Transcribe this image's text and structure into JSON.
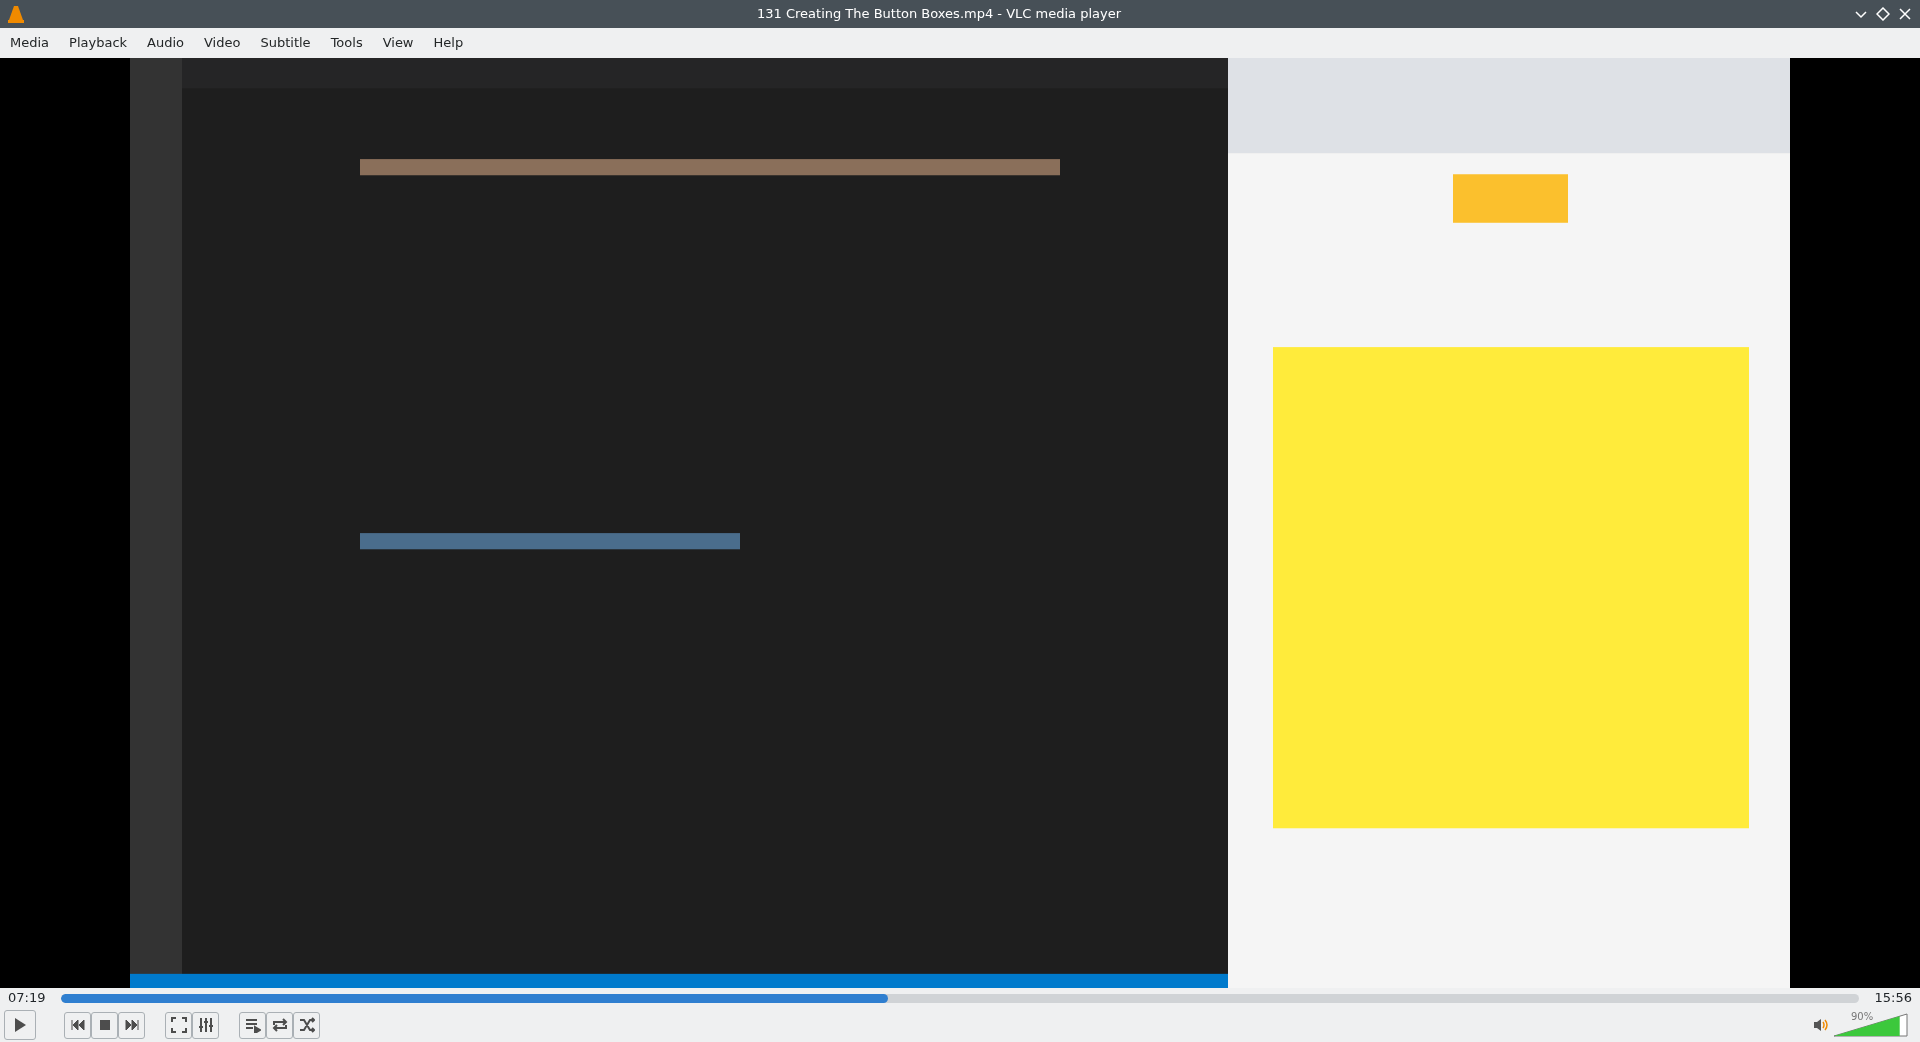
{
  "window": {
    "title": "131 Creating The Button Boxes.mp4 - VLC media player"
  },
  "menu": [
    "Media",
    "Playback",
    "Audio",
    "Video",
    "Subtitle",
    "Tools",
    "View",
    "Help"
  ],
  "seek": {
    "elapsed": "07:19",
    "total": "15:56",
    "level": 0.46
  },
  "volume": {
    "reading": "90%",
    "level": 0.9
  }
}
